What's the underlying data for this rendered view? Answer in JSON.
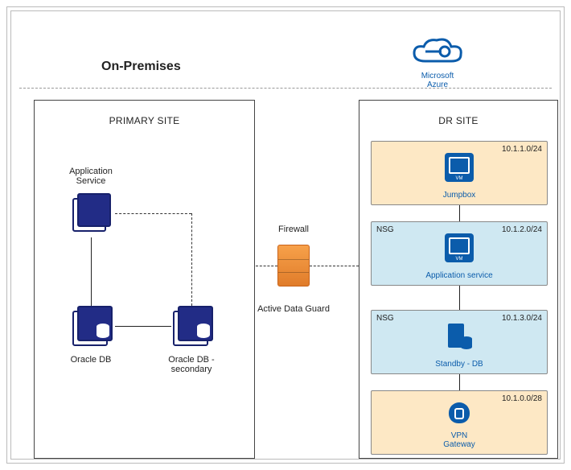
{
  "heading": "On-Premises",
  "cloud": {
    "name": "Microsoft\nAzure"
  },
  "primary_site": {
    "title": "PRIMARY SITE",
    "app_service": "Application\nService",
    "db_primary": "Oracle DB",
    "db_secondary": "Oracle DB -\nsecondary"
  },
  "firewall": {
    "label": "Firewall"
  },
  "data_guard": {
    "label": "Active Data Guard"
  },
  "dr_site": {
    "title": "DR SITE",
    "jumpbox": {
      "cidr": "10.1.1.0/24",
      "label": "Jumpbox"
    },
    "appservice": {
      "nsg": "NSG",
      "cidr": "10.1.2.0/24",
      "label": "Application service"
    },
    "standby": {
      "nsg": "NSG",
      "cidr": "10.1.3.0/24",
      "label": "Standby - DB"
    },
    "vpn": {
      "cidr": "10.1.0.0/28",
      "label": "VPN\nGateway"
    }
  }
}
